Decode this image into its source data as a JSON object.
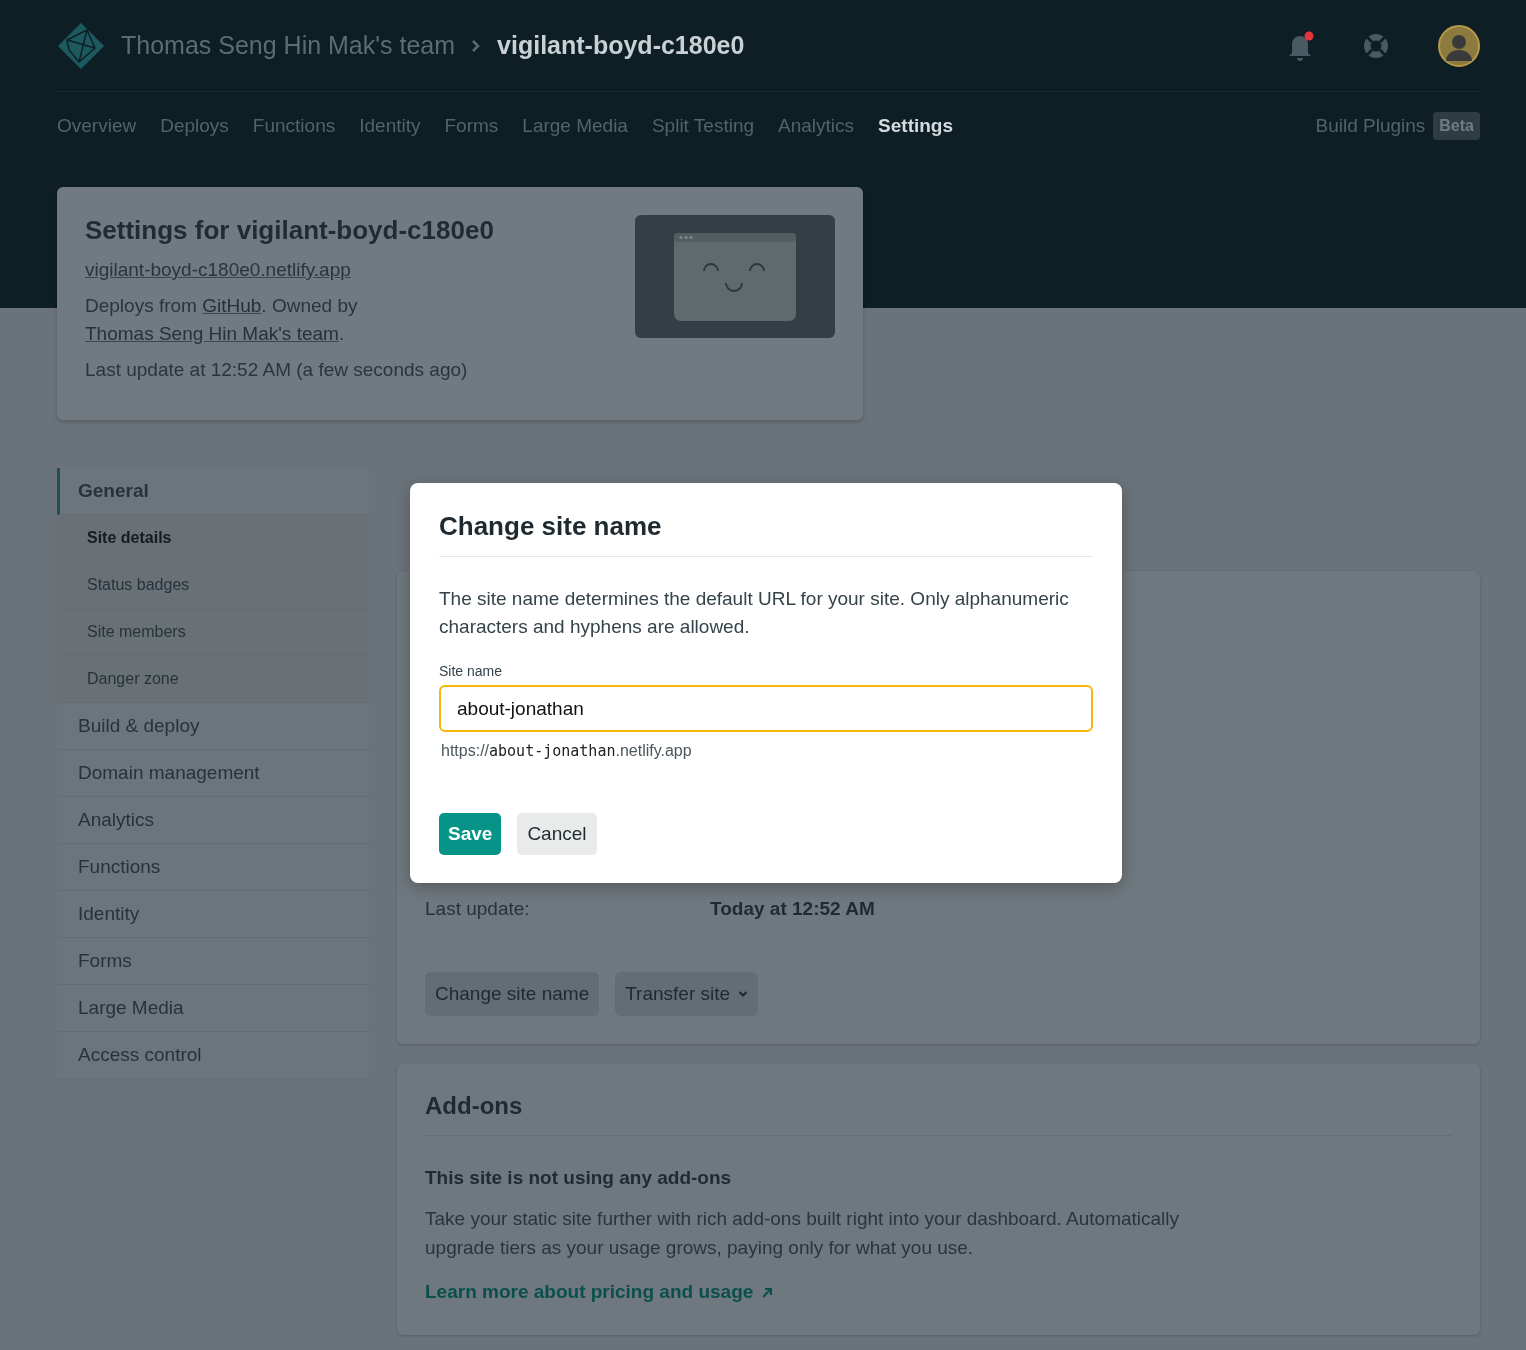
{
  "header": {
    "team": "Thomas Seng Hin Mak's team",
    "site_name": "vigilant-boyd-c180e0",
    "notifications_unread": true
  },
  "nav": {
    "tabs": [
      {
        "label": "Overview",
        "selected": false
      },
      {
        "label": "Deploys",
        "selected": false
      },
      {
        "label": "Functions",
        "selected": false
      },
      {
        "label": "Identity",
        "selected": false
      },
      {
        "label": "Forms",
        "selected": false
      },
      {
        "label": "Large Media",
        "selected": false
      },
      {
        "label": "Split Testing",
        "selected": false
      },
      {
        "label": "Analytics",
        "selected": false
      },
      {
        "label": "Settings",
        "selected": true
      }
    ],
    "plugins": {
      "label": "Build Plugins",
      "badge": "Beta"
    }
  },
  "summary": {
    "title": "Settings for vigilant-boyd-c180e0",
    "url": "vigilant-boyd-c180e0.netlify.app",
    "deploy_line": {
      "prefix": "Deploys from ",
      "repo": "GitHub",
      "middle": ". Owned by ",
      "owner": "Thomas Seng Hin Mak's team",
      "suffix": "."
    },
    "last_update": "Last update at 12:52 AM (a few seconds ago)"
  },
  "sidebar": {
    "items": [
      {
        "label": "General",
        "selected": true,
        "children": [
          {
            "label": "Site details",
            "selected": true
          },
          {
            "label": "Status badges",
            "selected": false
          },
          {
            "label": "Site members",
            "selected": false
          },
          {
            "label": "Danger zone",
            "selected": false
          }
        ]
      },
      {
        "label": "Build & deploy",
        "selected": false
      },
      {
        "label": "Domain management",
        "selected": false
      },
      {
        "label": "Analytics",
        "selected": false
      },
      {
        "label": "Functions",
        "selected": false
      },
      {
        "label": "Identity",
        "selected": false
      },
      {
        "label": "Forms",
        "selected": false
      },
      {
        "label": "Large Media",
        "selected": false
      },
      {
        "label": "Access control",
        "selected": false
      }
    ]
  },
  "site_details": {
    "last_update_label": "Last update:",
    "last_update_value": "Today at 12:52 AM",
    "buttons": [
      {
        "label": "Change site name",
        "kind": "plain"
      },
      {
        "label": "Transfer site",
        "kind": "dropdown"
      }
    ]
  },
  "addons": {
    "title": "Add-ons",
    "subtitle": "This site is not using any add-ons",
    "text": "Take your static site further with rich add-ons built right into your dashboard. Automatically upgrade tiers as your usage grows, paying only for what you use.",
    "link": "Learn more about pricing and usage"
  },
  "modal": {
    "title": "Change site name",
    "description": "The site name determines the default URL for your site. Only alphanumeric characters and hyphens are allowed.",
    "field_label": "Site name",
    "value": "about-jonathan",
    "url_hint": {
      "prefix": "https://",
      "name": "about-jonathan",
      "suffix": ".netlify.app"
    },
    "buttons": [
      {
        "label": "Save",
        "kind": "primary"
      },
      {
        "label": "Cancel",
        "kind": "secondary"
      }
    ]
  }
}
